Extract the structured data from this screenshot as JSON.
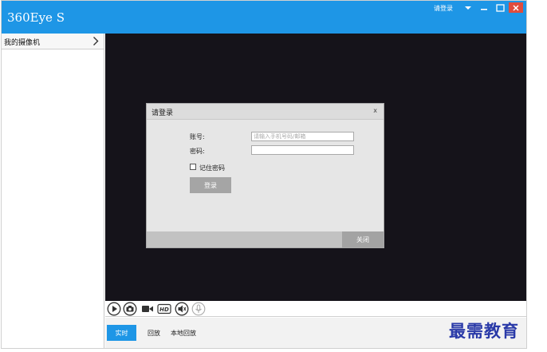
{
  "window": {
    "title": "360Eye S",
    "login_link": "请登录"
  },
  "sidebar": {
    "header_label": "我的摄像机"
  },
  "dialog": {
    "title": "请登录",
    "close_x": "x",
    "account_label": "账号:",
    "account_placeholder": "请输入手机号码/邮箱",
    "password_label": "密码:",
    "password_value": "",
    "remember_label": "记住密码",
    "remember_checked": false,
    "login_button": "登录",
    "close_button": "关闭"
  },
  "controls": {
    "icons": [
      "play-icon",
      "camera-icon",
      "video-record-icon",
      "hd-icon",
      "speaker-mute-icon",
      "microphone-icon"
    ],
    "hd_label": "HD"
  },
  "tabs": [
    {
      "label": "实时",
      "active": true
    },
    {
      "label": "回放",
      "active": false
    },
    {
      "label": "本地回放",
      "active": false
    }
  ],
  "watermark": "最需教育",
  "colors": {
    "accent": "#1e96e6",
    "video_bg": "#15131a",
    "close_red": "#e04c3c"
  }
}
